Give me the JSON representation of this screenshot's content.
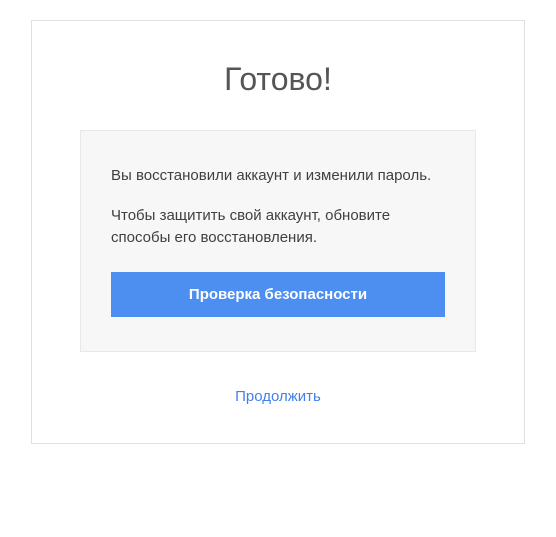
{
  "title": "Готово!",
  "card": {
    "message1": "Вы восстановили аккаунт и изменили пароль.",
    "message2": "Чтобы защитить свой аккаунт, обновите способы его восстановления.",
    "button_label": "Проверка безопасности"
  },
  "continue_label": "Продолжить"
}
